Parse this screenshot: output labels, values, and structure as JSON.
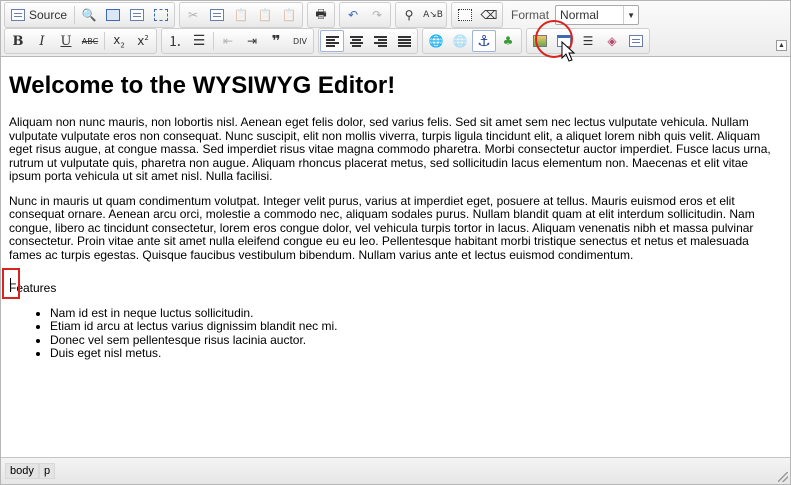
{
  "toolbar": {
    "source_label": "Source",
    "format_label": "Format",
    "format_value": "Normal"
  },
  "content": {
    "heading": "Welcome to the WYSIWYG Editor!",
    "paragraph1": "Aliquam non nunc mauris, non lobortis nisl. Aenean eget felis dolor, sed varius felis. Sed sit amet sem nec lectus vulputate vehicula. Nullam vulputate vulputate eros non consequat. Nunc suscipit, elit non mollis viverra, turpis ligula tincidunt elit, a aliquet lorem nibh quis velit. Aliquam eget risus augue, at congue massa. Sed imperdiet risus vitae magna commodo pharetra. Morbi consectetur auctor imperdiet. Fusce lacus urna, rutrum ut vulputate quis, pharetra non augue. Aliquam rhoncus placerat metus, sed sollicitudin lacus elementum non. Maecenas et elit vitae ipsum porta vehicula ut sit amet nisl. Nulla facilisi.",
    "paragraph2": "Nunc in mauris ut quam condimentum volutpat. Integer velit purus, varius at imperdiet eget, posuere at tellus. Mauris euismod eros et elit consequat ornare. Aenean arcu orci, molestie a commodo nec, aliquam sodales purus. Nullam blandit quam at elit interdum sollicitudin. Nam congue, libero ac tincidunt consectetur, lorem eros congue dolor, vel vehicula turpis tortor in lacus. Aliquam venenatis nibh et massa pulvinar consectetur. Proin vitae ante sit amet nulla eleifend congue eu eu leo. Pellentesque habitant morbi tristique senectus et netus et malesuada fames ac turpis egestas. Quisque faucibus vestibulum bibendum. Nullam varius ante et lectus euismod condimentum.",
    "features_label": "Features",
    "list_items": [
      "Nam id est in neque luctus sollicitudin.",
      "Etiam id arcu at lectus varius dignissim blandit nec mi.",
      "Donec vel sem pellentesque risus lacinia auctor.",
      "Duis eget nisl metus."
    ]
  },
  "statusbar": {
    "path": [
      "body",
      "p"
    ]
  },
  "colors": {
    "highlight": "#d9231f",
    "toolbar_border": "#b6b6b6",
    "active_button_border": "#9eb4d8"
  }
}
